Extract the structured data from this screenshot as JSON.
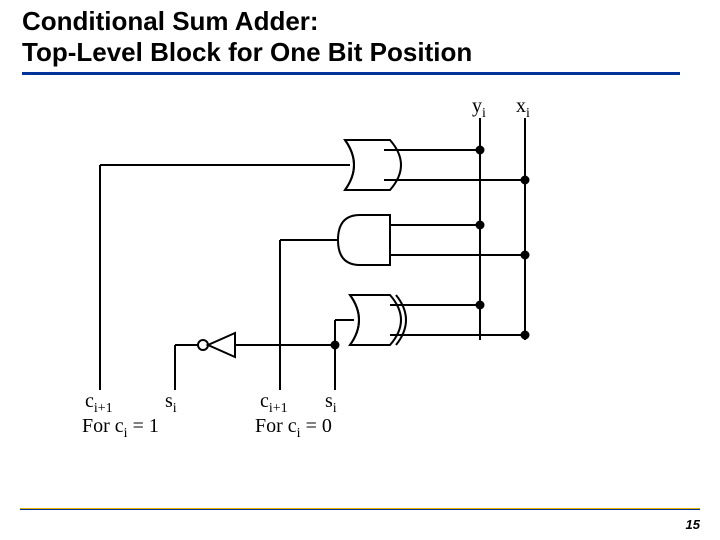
{
  "title_line1": "Conditional Sum Adder:",
  "title_line2": "Top-Level Block for One Bit Position",
  "labels": {
    "y": "y",
    "y_sub": "i",
    "x": "x",
    "x_sub": "i",
    "c_left": "c",
    "c_left_sub": "i+1",
    "s_left": "s",
    "s_left_sub": "i",
    "c_right": "c",
    "c_right_sub": "i+1",
    "s_right": "s",
    "s_right_sub": "i",
    "for1a": "For c",
    "for1b": "i",
    "for1c": " = 1",
    "for0a": "For c",
    "for0b": "i",
    "for0c": " = 0"
  },
  "page_number": "15"
}
